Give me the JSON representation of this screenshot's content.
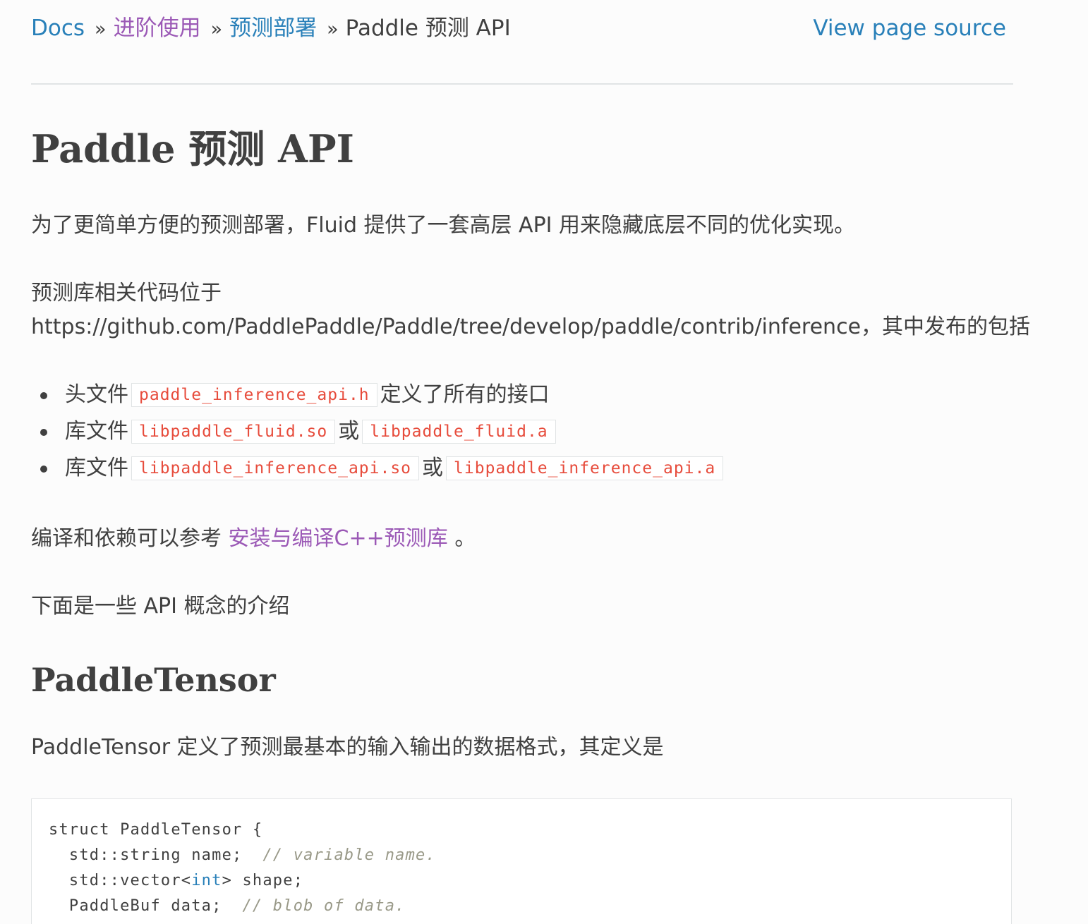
{
  "breadcrumb": {
    "items": [
      {
        "label": "Docs"
      },
      {
        "label": "进阶使用"
      },
      {
        "label": "预测部署"
      },
      {
        "label": "Paddle 预测 API"
      }
    ],
    "separator": "»",
    "view_source": "View page source"
  },
  "title": "Paddle 预测 API",
  "paragraphs": {
    "intro": "为了更简单方便的预测部署，Fluid 提供了一套高层 API 用来隐藏底层不同的优化实现。",
    "location_line1": "预测库相关代码位于",
    "location_line2": "https://github.com/PaddlePaddle/Paddle/tree/develop/paddle/contrib/inference，其中发布的包括",
    "build_prefix": "编译和依赖可以参考",
    "build_link": "安装与编译C++预测库",
    "build_suffix": "。",
    "concepts": "下面是一些 API 概念的介绍",
    "tensor_desc": "PaddleTensor 定义了预测最基本的输入输出的数据格式，其定义是"
  },
  "bullets": [
    {
      "prefix": "头文件",
      "code1": "paddle_inference_api.h",
      "middle": "定义了所有的接口",
      "code2": ""
    },
    {
      "prefix": "库文件",
      "code1": "libpaddle_fluid.so",
      "middle": "或",
      "code2": "libpaddle_fluid.a"
    },
    {
      "prefix": "库文件",
      "code1": "libpaddle_inference_api.so",
      "middle": "或",
      "code2": "libpaddle_inference_api.a"
    }
  ],
  "section_heading": "PaddleTensor",
  "code": {
    "line1": "struct PaddleTensor {",
    "line2_code": "  std::string name;  ",
    "line2_comment": "// variable name.",
    "line3_pre": "  std::vector<",
    "line3_kw": "int",
    "line3_post": "> shape;",
    "line4_code": "  PaddleBuf data;  ",
    "line4_comment": "// blob of data."
  }
}
